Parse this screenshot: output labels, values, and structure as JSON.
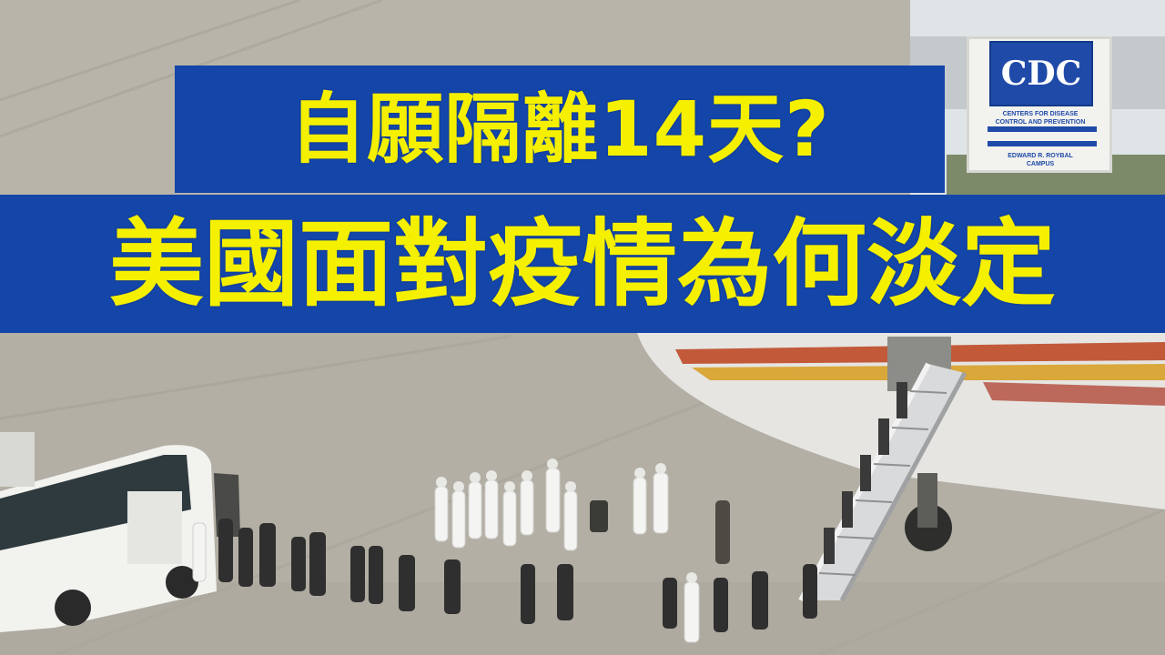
{
  "headline": {
    "line1": "自願隔離14天?",
    "line2": "美國面對疫情為何淡定"
  },
  "cdc_sign": {
    "logo_text": "CDC",
    "caption": "CENTERS FOR DISEASE\nCONTROL AND PREVENTION",
    "campus": "EDWARD R. ROYBAL\nCAMPUS"
  },
  "colors": {
    "banner_background": "#1445a8",
    "banner_text": "#f5f000",
    "cdc_blue": "#1f4aa8",
    "tarmac": "#b7b3a8"
  }
}
